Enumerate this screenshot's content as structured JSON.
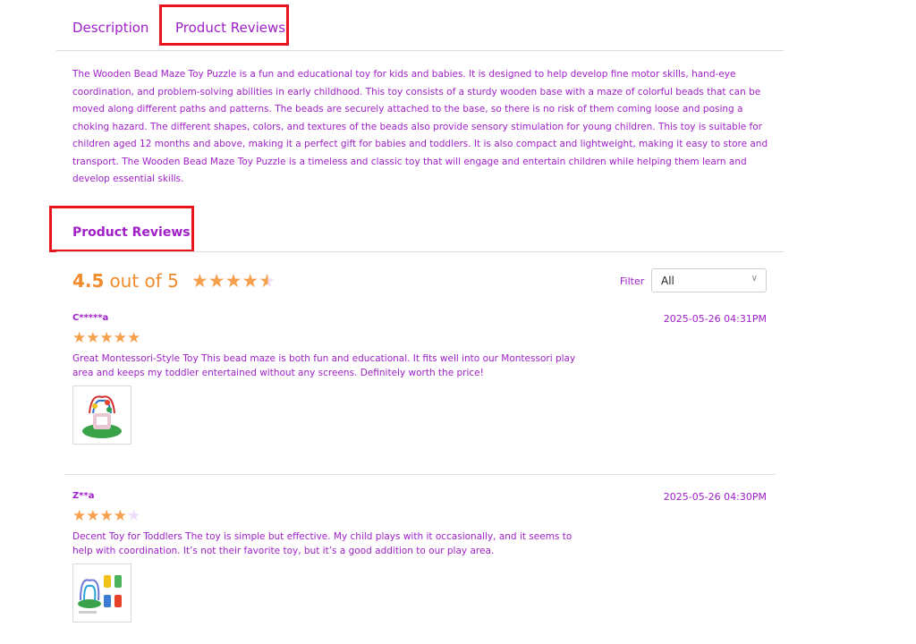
{
  "tabs": [
    {
      "label": "Description"
    },
    {
      "label": "Product Reviews"
    }
  ],
  "description": "The Wooden Bead Maze Toy Puzzle is a fun and educational toy for kids and babies. It is designed to help develop fine motor skills, hand-eye coordination, and problem-solving abilities in early childhood. This toy consists of a sturdy wooden base with a maze of colorful beads that can be moved along different paths and patterns. The beads are securely attached to the base, so there is no risk of them coming loose and posing a choking hazard. The different shapes, colors, and textures of the beads also provide sensory stimulation for young children. This toy is suitable for children aged 12 months and above, making it a perfect gift for babies and toddlers. It is also compact and lightweight, making it easy to store and transport. The Wooden Bead Maze Toy Puzzle is a timeless and classic toy that will engage and entertain children while helping them learn and develop essential skills.",
  "reviews_section": {
    "title": "Product Reviews",
    "score": "4.5",
    "out_of": "out of 5",
    "rating": 4.5,
    "filter_label": "Filter",
    "filter_value": "All"
  },
  "reviews": [
    {
      "user": "C*****a",
      "date": "2025-05-26 04:31PM",
      "rating": 5,
      "text": "Great Montessori-Style Toy This bead maze is both fun and educational. It fits well into our Montessori play area and keeps my toddler entertained without any screens. Definitely worth the price!"
    },
    {
      "user": "Z**a",
      "date": "2025-05-26 04:30PM",
      "rating": 4,
      "text": "Decent Toy for Toddlers The toy is simple but effective. My child plays with it occasionally, and it seems to help with coordination. It’s not their favorite toy, but it’s a good addition to our play area."
    }
  ],
  "colors": {
    "accent": "#a020c8",
    "star": "#f6a04d",
    "score": "#f28a2e",
    "highlight": "#e8141e"
  }
}
